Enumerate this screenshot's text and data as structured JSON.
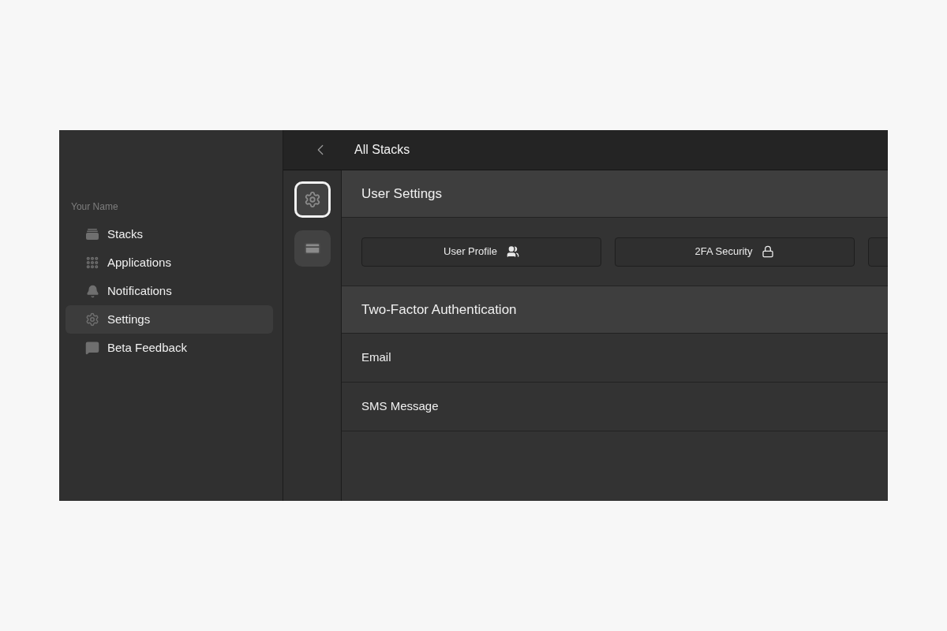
{
  "sidebar": {
    "user_name": "Your Name",
    "items": [
      {
        "label": "Stacks",
        "kind": "stacks",
        "selected": false
      },
      {
        "label": "Applications",
        "kind": "grid",
        "selected": false
      },
      {
        "label": "Notifications",
        "kind": "bell",
        "selected": false
      },
      {
        "label": "Settings",
        "kind": "gear",
        "selected": true
      },
      {
        "label": "Beta Feedback",
        "kind": "chat",
        "selected": false
      }
    ]
  },
  "header": {
    "title": "All Stacks"
  },
  "rail": [
    {
      "kind": "gear",
      "selected": true
    },
    {
      "kind": "card",
      "selected": false
    }
  ],
  "user_settings": {
    "title": "User Settings",
    "buttons": [
      {
        "kind": "profile",
        "label": "User Profile"
      },
      {
        "kind": "security",
        "label": "2FA Security"
      },
      {
        "kind": "cut"
      }
    ]
  },
  "two_factor": {
    "title": "Two-Factor Authentication",
    "rows": [
      {
        "label": "Email"
      },
      {
        "label": "SMS Message"
      }
    ]
  }
}
